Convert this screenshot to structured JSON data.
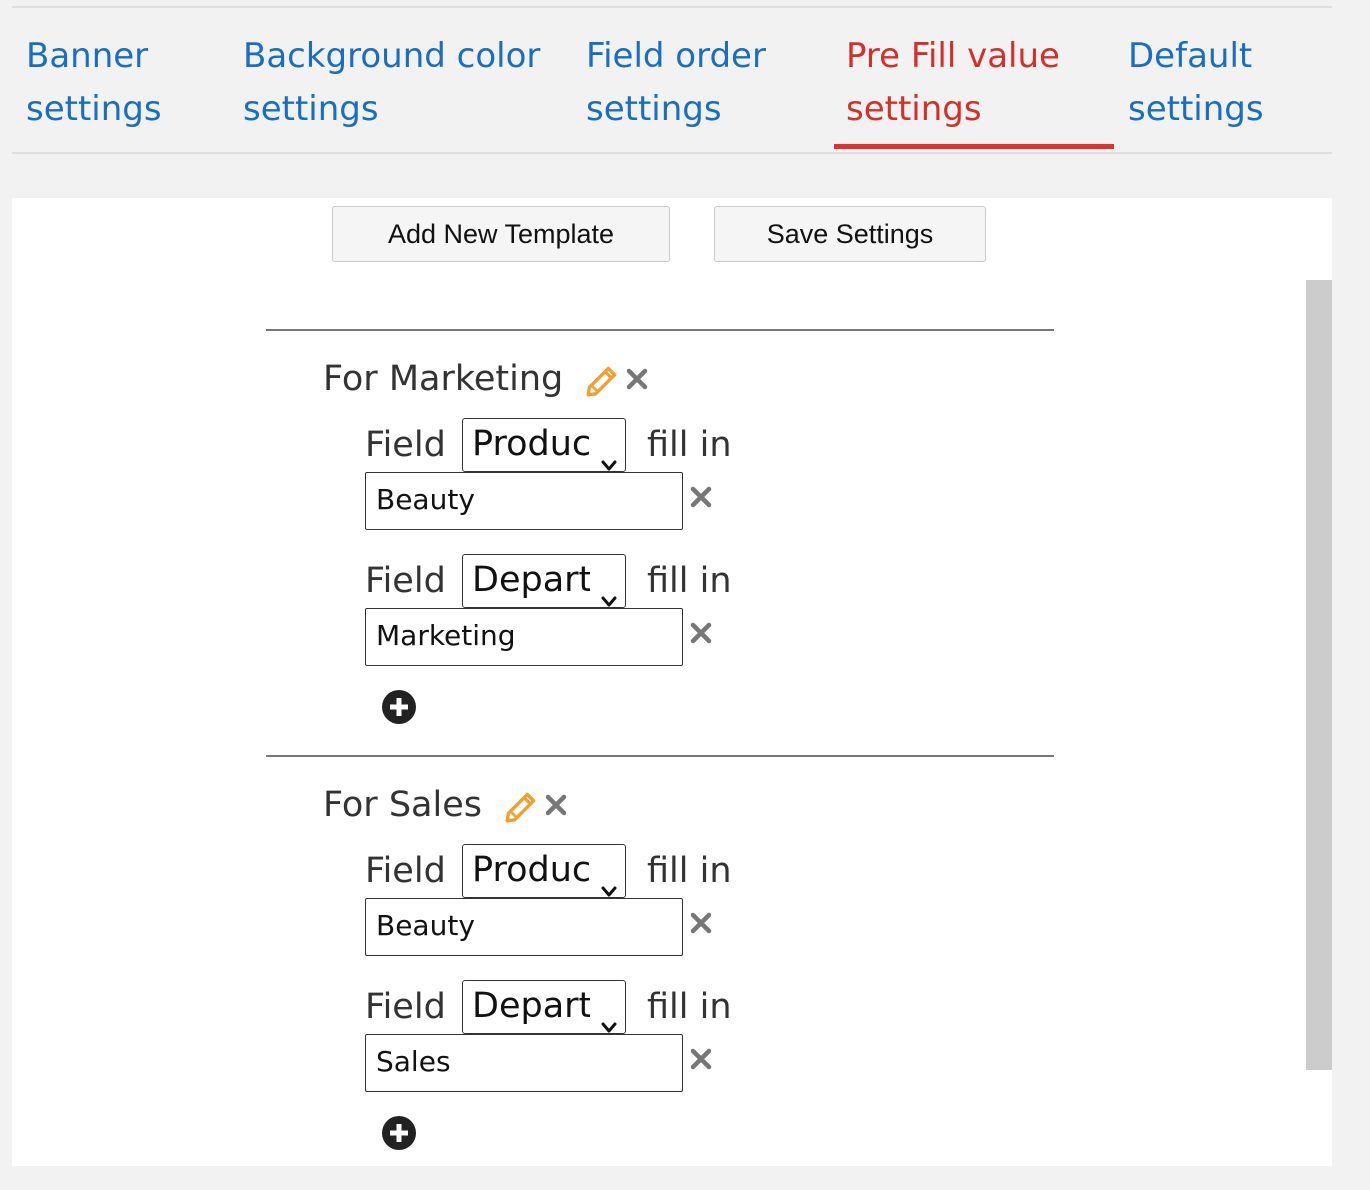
{
  "tabs": [
    {
      "line1": "Banner",
      "line2": "settings"
    },
    {
      "line1": "Background color",
      "line2": "settings"
    },
    {
      "line1": "Field order",
      "line2": "settings"
    },
    {
      "line1": "Pre Fill value",
      "line2": "settings"
    },
    {
      "line1": "Default",
      "line2": "settings"
    }
  ],
  "active_tab_index": 3,
  "toolbar": {
    "add_template_label": "Add New Template",
    "save_settings_label": "Save Settings"
  },
  "colors": {
    "tab_link": "#1a6ec2",
    "tab_active": "#d3302a",
    "pencil_icon": "#f0a030",
    "close_icon": "#777777"
  },
  "templates": [
    {
      "name": "For Marketing",
      "rules": [
        {
          "field_label": "Field",
          "field_select": "Produc",
          "fill_label": "fill in",
          "value": "Beauty"
        },
        {
          "field_label": "Field",
          "field_select": "Departi",
          "fill_label": "fill in",
          "value": "Marketing"
        }
      ]
    },
    {
      "name": "For Sales",
      "rules": [
        {
          "field_label": "Field",
          "field_select": "Produc",
          "fill_label": "fill in",
          "value": "Beauty"
        },
        {
          "field_label": "Field",
          "field_select": "Departi",
          "fill_label": "fill in",
          "value": "Sales"
        }
      ]
    }
  ]
}
